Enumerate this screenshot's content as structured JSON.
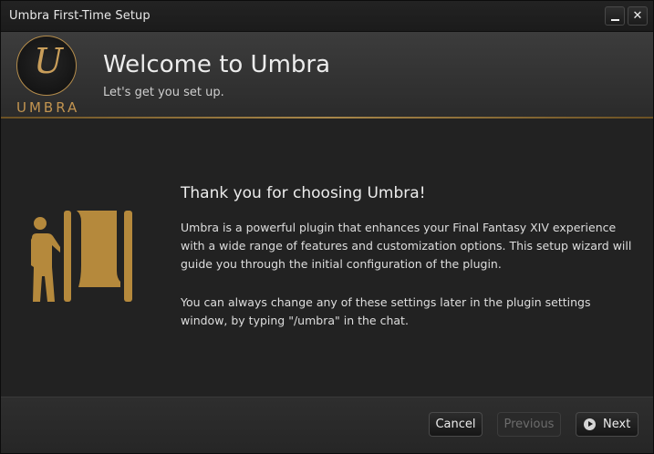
{
  "window": {
    "title": "Umbra First-Time Setup",
    "minimize_icon": "minimize-icon",
    "close_icon": "close-icon",
    "close_glyph": "✕"
  },
  "header": {
    "logo": {
      "monogram": "U",
      "wordmark": "UMBRA"
    },
    "title": "Welcome to Umbra",
    "subtitle": "Let's get you set up."
  },
  "content": {
    "illustration_icon": "person-entering-door-icon",
    "heading": "Thank you for choosing Umbra!",
    "paragraph1": "Umbra is a powerful plugin that enhances your Final Fantasy XIV experience with a wide range of features and customization options. This setup wizard will guide you through the initial configuration of the plugin.",
    "paragraph2": "You can always change any of these settings later in the plugin settings window, by typing \"/umbra\" in the chat."
  },
  "footer": {
    "cancel_label": "Cancel",
    "previous_label": "Previous",
    "previous_enabled": false,
    "next_label": "Next",
    "next_icon": "chevron-right-circle-icon"
  },
  "colors": {
    "accent_gold": "#b58d4c",
    "background": "#222222",
    "text": "#ececec"
  }
}
